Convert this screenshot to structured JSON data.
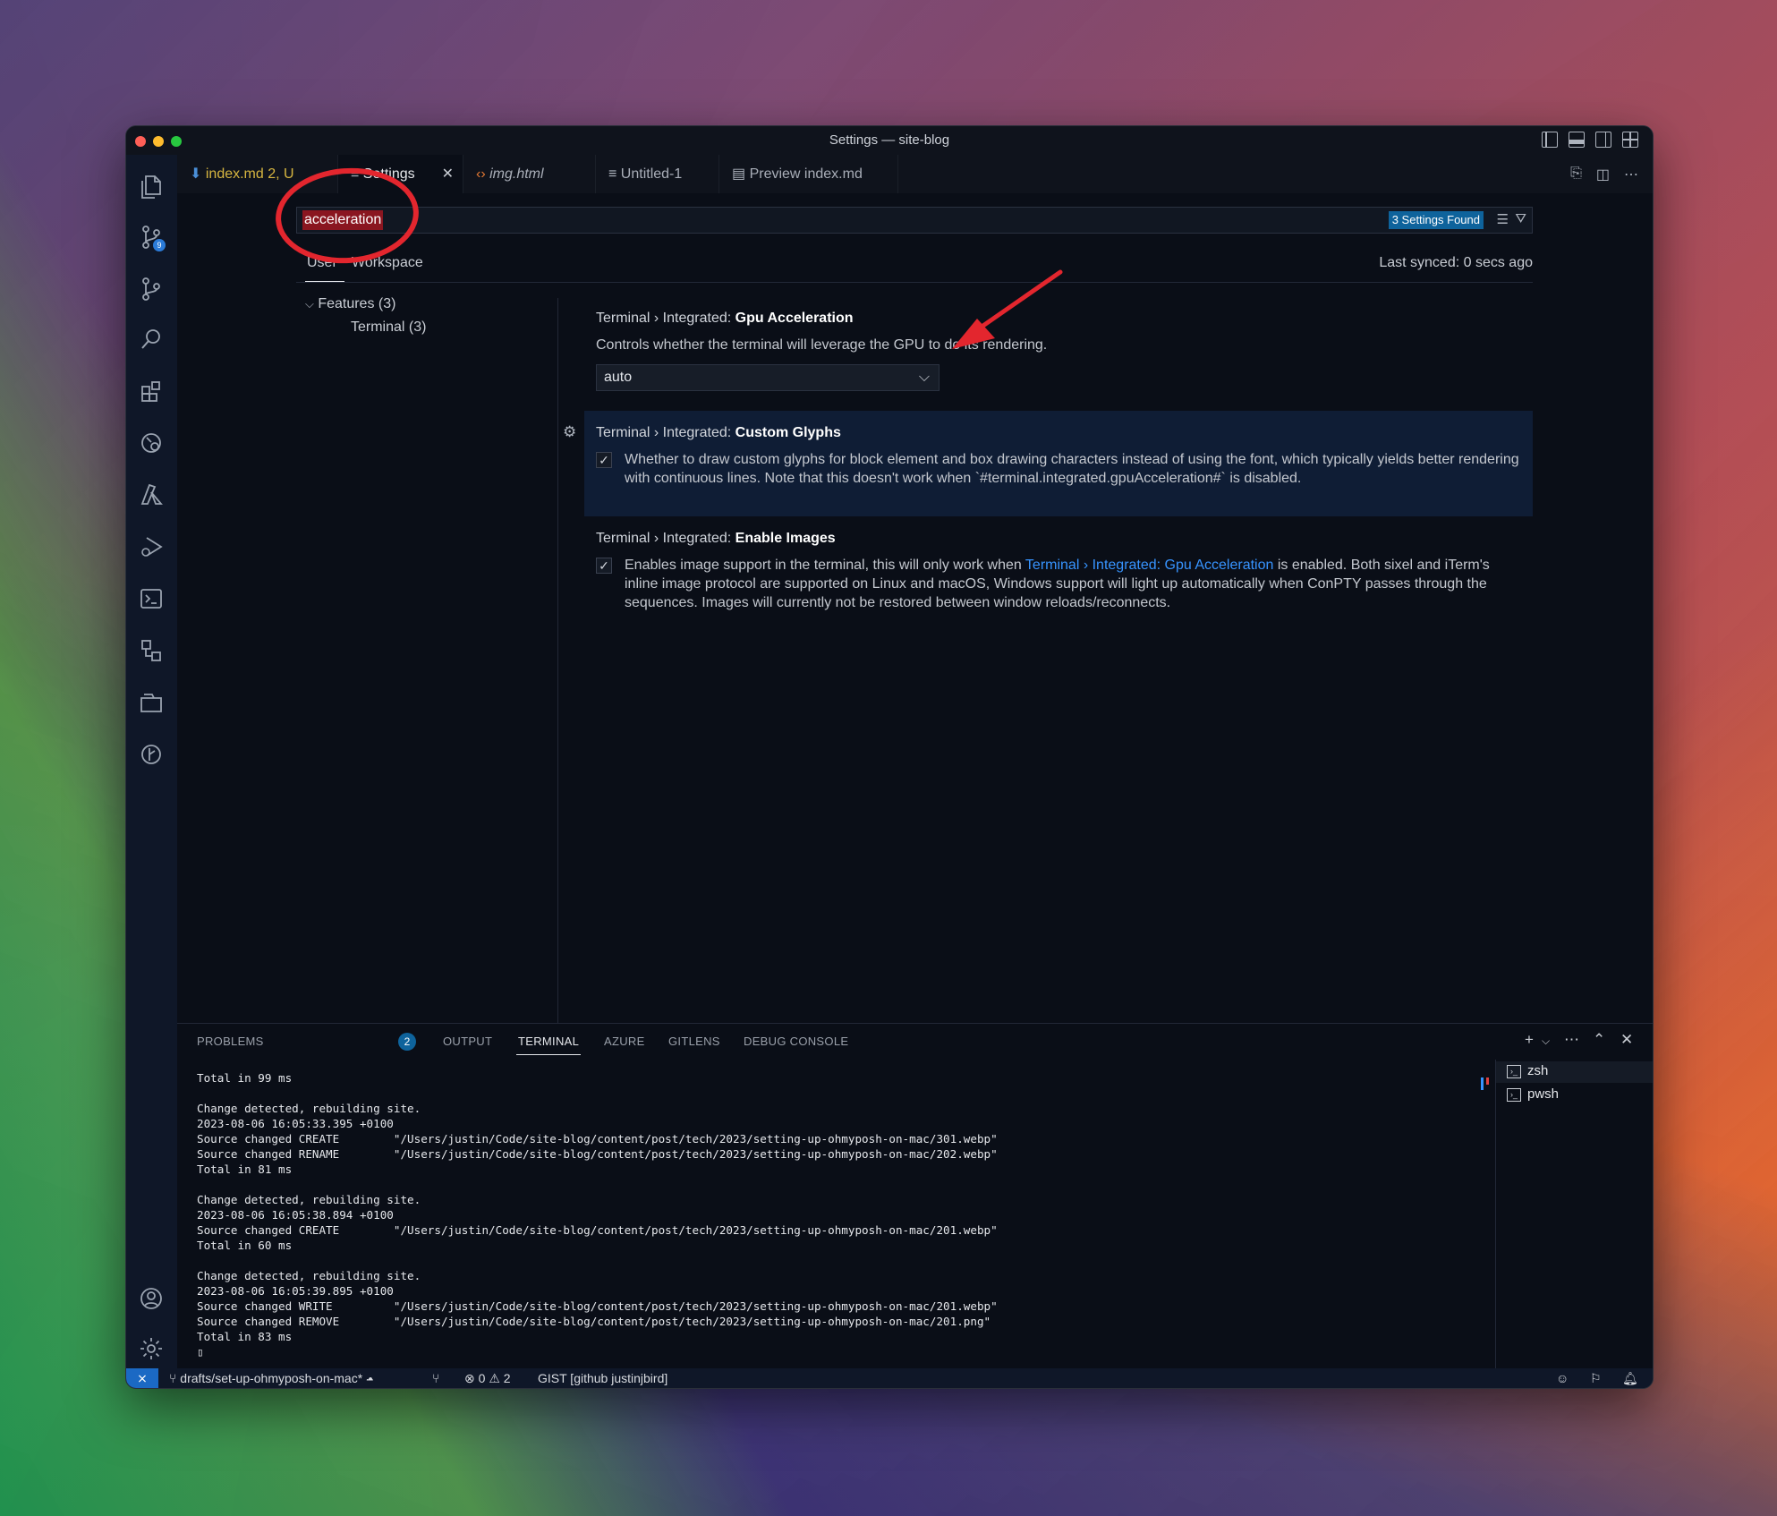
{
  "window": {
    "title": "Settings — site-blog"
  },
  "tabs": [
    {
      "label": "index.md",
      "status": "2, U",
      "icon": "markdown-icon"
    },
    {
      "label": "Settings",
      "icon": "settings-file-icon",
      "close": "✕"
    },
    {
      "label": "img.html",
      "icon": "html-icon"
    },
    {
      "label": "Untitled-1",
      "icon": "text-file-icon"
    },
    {
      "label": "Preview index.md",
      "icon": "preview-icon"
    }
  ],
  "activity_bar": {
    "source_control_badge": "9"
  },
  "settings": {
    "search_value": "acceleration",
    "found": "3 Settings Found",
    "scope_user": "User",
    "scope_workspace": "Workspace",
    "last_synced": "Last synced: 0 secs ago",
    "toc": {
      "features": "Features (3)",
      "terminal": "Terminal (3)"
    },
    "items": [
      {
        "category": "Terminal › Integrated:",
        "title": "Gpu Acceleration",
        "description": "Controls whether the terminal will leverage the GPU to do its rendering.",
        "value": "auto"
      },
      {
        "category": "Terminal › Integrated:",
        "title": "Custom Glyphs",
        "description": "Whether to draw custom glyphs for block element and box drawing characters instead of using the font, which typically yields better rendering with continuous lines. Note that this doesn't work when `#terminal.integrated.gpuAcceleration#` is disabled.",
        "checked": true
      },
      {
        "category": "Terminal › Integrated:",
        "title": "Enable Images",
        "description_pre": "Enables image support in the terminal, this will only work when ",
        "description_link": "Terminal › Integrated: Gpu Acceleration",
        "description_post": " is enabled. Both sixel and iTerm's inline image protocol are supported on Linux and macOS, Windows support will light up automatically when ConPTY passes through the sequences. Images will currently not be restored between window reloads/reconnects.",
        "checked": true
      }
    ]
  },
  "panel": {
    "tabs": [
      "PROBLEMS",
      "OUTPUT",
      "TERMINAL",
      "AZURE",
      "GITLENS",
      "DEBUG CONSOLE"
    ],
    "problems_count": "2",
    "terminal_output": "Total in 99 ms\n\nChange detected, rebuilding site.\n2023-08-06 16:05:33.395 +0100\nSource changed CREATE        \"/Users/justin/Code/site-blog/content/post/tech/2023/setting-up-ohmyposh-on-mac/301.webp\"\nSource changed RENAME        \"/Users/justin/Code/site-blog/content/post/tech/2023/setting-up-ohmyposh-on-mac/202.webp\"\nTotal in 81 ms\n\nChange detected, rebuilding site.\n2023-08-06 16:05:38.894 +0100\nSource changed CREATE        \"/Users/justin/Code/site-blog/content/post/tech/2023/setting-up-ohmyposh-on-mac/201.webp\"\nTotal in 60 ms\n\nChange detected, rebuilding site.\n2023-08-06 16:05:39.895 +0100\nSource changed WRITE         \"/Users/justin/Code/site-blog/content/post/tech/2023/setting-up-ohmyposh-on-mac/201.webp\"\nSource changed REMOVE        \"/Users/justin/Code/site-blog/content/post/tech/2023/setting-up-ohmyposh-on-mac/201.png\"\nTotal in 83 ms\n▯",
    "terminals": [
      "zsh",
      "pwsh"
    ]
  },
  "statusbar": {
    "branch": "drafts/set-up-ohmyposh-on-mac*",
    "errors": "0",
    "warnings": "2",
    "gist": "GIST [github justinjbird]"
  },
  "colors": {
    "accent": "#0e639c",
    "annotation": "#e3262e",
    "link": "#3794ff"
  }
}
